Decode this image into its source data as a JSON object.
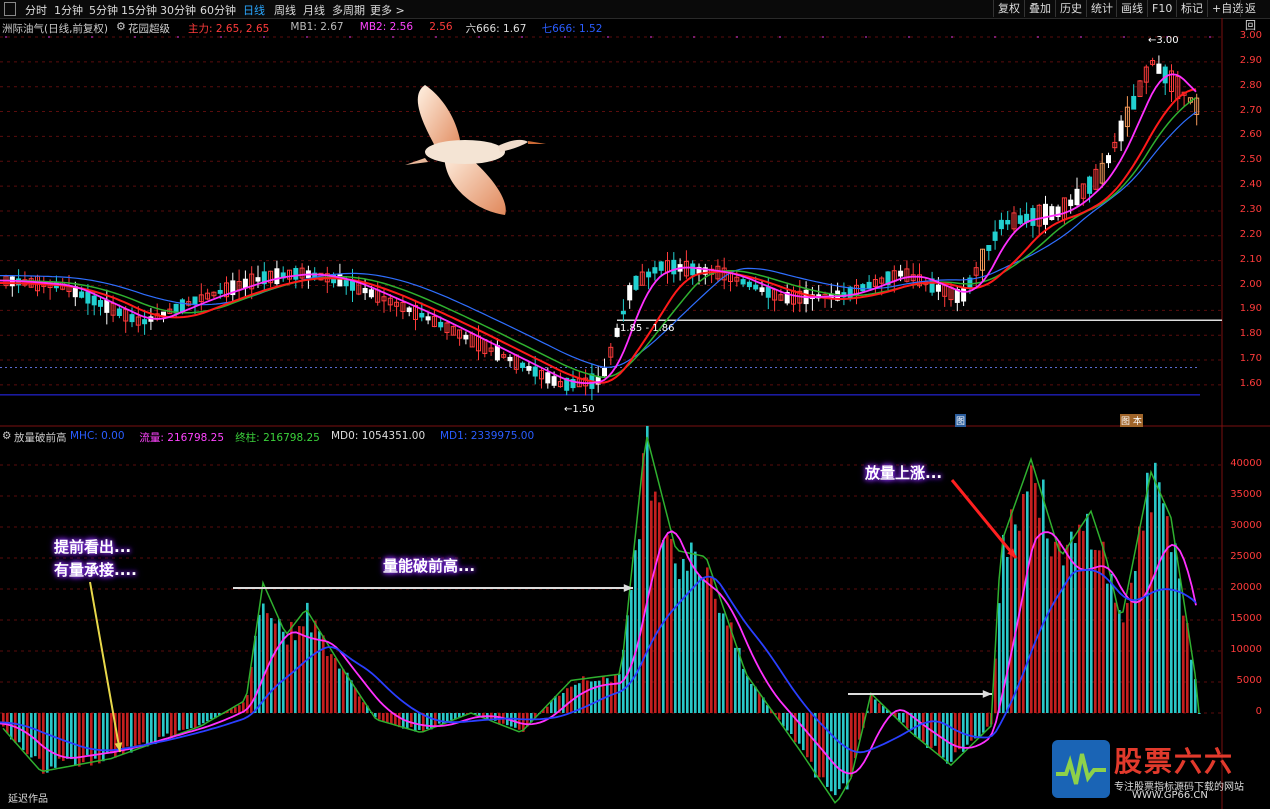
{
  "toolbar": {
    "timeframes": [
      {
        "label": "分时",
        "x": 25
      },
      {
        "label": "1分钟",
        "x": 54
      },
      {
        "label": "5分钟",
        "x": 89
      },
      {
        "label": "15分钟",
        "x": 121
      },
      {
        "label": "30分钟",
        "x": 160
      },
      {
        "label": "60分钟",
        "x": 200
      },
      {
        "label": "日线",
        "x": 243,
        "active": true
      },
      {
        "label": "周线",
        "x": 274
      },
      {
        "label": "月线",
        "x": 303
      },
      {
        "label": "多周期",
        "x": 332
      },
      {
        "label": "更多 >",
        "x": 370
      }
    ],
    "right_buttons": [
      {
        "label": "复权",
        "x": 993
      },
      {
        "label": "叠加",
        "x": 1024
      },
      {
        "label": "历史",
        "x": 1055
      },
      {
        "label": "统计",
        "x": 1086
      },
      {
        "label": "画线",
        "x": 1116
      },
      {
        "label": "F10",
        "x": 1147
      },
      {
        "label": "标记",
        "x": 1176
      },
      {
        "label": "+自选",
        "x": 1207
      },
      {
        "label": "返回",
        "x": 1240
      }
    ]
  },
  "top_legend": {
    "title": "洲际油气(日线,前复权)",
    "indicator": "花园超级",
    "items": [
      {
        "text": "主力: 2.65, 2.65",
        "color": "#ff3b3b"
      },
      {
        "text": "MB1: 2.67",
        "color": "#bbbbbb"
      },
      {
        "text": "MB2: 2.56",
        "color": "#ff44ff"
      },
      {
        "text": "2.56",
        "color": "#ff3b3b"
      },
      {
        "text": "六666: 1.67",
        "color": "#dddddd"
      },
      {
        "text": "七666: 1.52",
        "color": "#2a5dff"
      }
    ]
  },
  "bottom_legend": {
    "title": "放量破前高",
    "items": [
      {
        "text": "MHC: 0.00",
        "color": "#2a5dff"
      },
      {
        "text": "流量: 216798.25",
        "color": "#ff44ff"
      },
      {
        "text": "终柱: 216798.25",
        "color": "#3bd13b"
      },
      {
        "text": "MD0: 1054351.00",
        "color": "#dddddd"
      },
      {
        "text": "MD1: 2339975.00",
        "color": "#2a5dff"
      }
    ]
  },
  "price_axis": {
    "labels": [
      "3.00",
      "2.90",
      "2.80",
      "2.70",
      "2.60",
      "2.50",
      "2.40",
      "2.30",
      "2.20",
      "2.10",
      "2.00",
      "1.90",
      "1.80",
      "1.70",
      "1.60"
    ],
    "color": "#ff3b3b"
  },
  "volume_axis": {
    "labels": [
      "40000",
      "35000",
      "30000",
      "25000",
      "20000",
      "15000",
      "10000",
      "5000",
      "0"
    ],
    "color": "#ff3b3b"
  },
  "price_notes": {
    "high_marker": "←3.00",
    "low_marker": "←1.50",
    "support_label": "1.85 - 1.86",
    "badge_a": "图",
    "badge_b": "图 本"
  },
  "annotations": {
    "early_signal_line1": "提前看出...",
    "early_signal_line2": "有量承接....",
    "volume_break": "量能破前高...",
    "volume_rise": "放量上涨..."
  },
  "footer_left": "延迟作品",
  "logo": {
    "name": "股票六六",
    "tagline": "专注股票指标源码下载的网站",
    "url": "WWW.GP66.CN"
  },
  "chart_data": {
    "type": "candlestick",
    "title": "洲际油气(日线,前复权)",
    "price_range": [
      1.5,
      3.0
    ],
    "volume_indicator_range": [
      -5000,
      45000
    ],
    "notable_levels": {
      "high": 3.0,
      "low": 1.5,
      "support": 1.86
    },
    "series": [
      {
        "name": "主力",
        "color": "#ff3b3b"
      },
      {
        "name": "MB1",
        "color": "#bbbbbb"
      },
      {
        "name": "MB2",
        "color": "#ff44ff"
      },
      {
        "name": "七666",
        "color": "#2a5dff"
      },
      {
        "name": "流量",
        "color": "#ff44ff"
      },
      {
        "name": "终柱",
        "color": "#3bd13b"
      },
      {
        "name": "MD1",
        "color": "#2a5dff"
      }
    ]
  }
}
